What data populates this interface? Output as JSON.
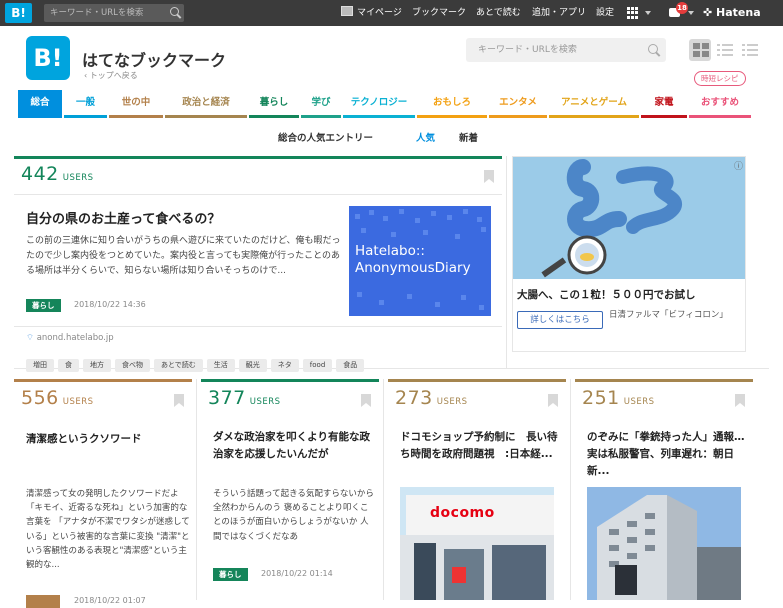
{
  "topbar": {
    "logo": "B!",
    "search_placeholder": "キーワード・URLを検索",
    "mypage": "マイページ",
    "bookmark": "ブックマーク",
    "read_later": "あとで読む",
    "add_app": "追加・アプリ",
    "settings": "設定",
    "notification_count": "18",
    "hatena": "Hatena"
  },
  "header": {
    "logo": "B!",
    "title": "はてなブックマーク",
    "back_link": "‹ トップへ戻る",
    "search_placeholder": "キーワード・URLを検索"
  },
  "categories": [
    {
      "label": "総合",
      "color": "#008fde"
    },
    {
      "label": "一般",
      "color": "#00a0d8"
    },
    {
      "label": "世の中",
      "color": "#b3804a"
    },
    {
      "label": "政治と経済",
      "color": "#a5854f"
    },
    {
      "label": "暮らし",
      "color": "#13855a"
    },
    {
      "label": "学び",
      "color": "#1ea18a"
    },
    {
      "label": "テクノロジー",
      "color": "#0bb1d3"
    },
    {
      "label": "おもしろ",
      "color": "#f3a112"
    },
    {
      "label": "エンタメ",
      "color": "#ee9b1d"
    },
    {
      "label": "アニメとゲーム",
      "color": "#e2a419"
    },
    {
      "label": "家電",
      "color": "#c1131b"
    },
    {
      "label": "おすすめ",
      "color": "#ea5379"
    }
  ],
  "recipe_tag": "時短レシピ",
  "subnav": {
    "title": "総合の人気エントリー",
    "popular": "人気",
    "new": "新着"
  },
  "featured": {
    "users": "442",
    "users_label": "USERS",
    "title": "自分の県のお土産って食べるの？",
    "summary": "この前の三連休に知り合いがうちの県へ遊びに来ていたのだけど、俺も暇だったので少し案内役をつとめていた。案内役と言っても実際俺が行ったことのある場所は半分くらいで、知らない場所は知り合いそっちのけで...",
    "category": "暮らし",
    "date": "2018/10/22 14:36",
    "thumb_line1": "Hatelabo::",
    "thumb_line2": "AnonymousDiary",
    "domain": "anond.hatelabo.jp",
    "tags": [
      "増田",
      "食",
      "地方",
      "食べ物",
      "あとで読む",
      "生活",
      "観光",
      "ネタ",
      "food",
      "食品"
    ]
  },
  "ad": {
    "title": "大腸へ、この１粒！５００円でお試し",
    "button": "詳しくはこちら",
    "sponsor": "日清ファルマ「ビフィコロン」",
    "info_icon": "ⓘ"
  },
  "entries": [
    {
      "users": "556",
      "users_label": "USERS",
      "color": "#b3804a",
      "title": "清潔感というクソワード",
      "summary": "清潔感って女の発明したクソワードだよ 「キモイ、近寄るな死ね」という加害的な言葉を 「アナタが不潔でワタシが迷惑している」という被害的な言葉に変換 \"清潔\"という客観性のある表現と\"清潔感\"という主観的な...",
      "category": "",
      "date": "2018/10/22 01:07"
    },
    {
      "users": "377",
      "users_label": "USERS",
      "color": "#13855a",
      "title": "ダメな政治家を叩くより有能な政治家を応援したいんだが",
      "summary": "そういう話題って起きる気配すらないから全然わからんのう 褒めることより叩くことのほうが面白いからしょうがないか 人間ではなくづくだなあ",
      "category": "暮らし",
      "date": "2018/10/22 01:14"
    },
    {
      "users": "273",
      "users_label": "USERS",
      "color": "#a5854f",
      "title": "ドコモショップ予約制に　長い待ち時間を政府問題視　:日本経...",
      "thumb": "docomo"
    },
    {
      "users": "251",
      "users_label": "USERS",
      "color": "#a5854f",
      "title": "のぞみに「拳銃持った人」通報…実は私服警官、列車遅れ：朝日新..."
    }
  ]
}
